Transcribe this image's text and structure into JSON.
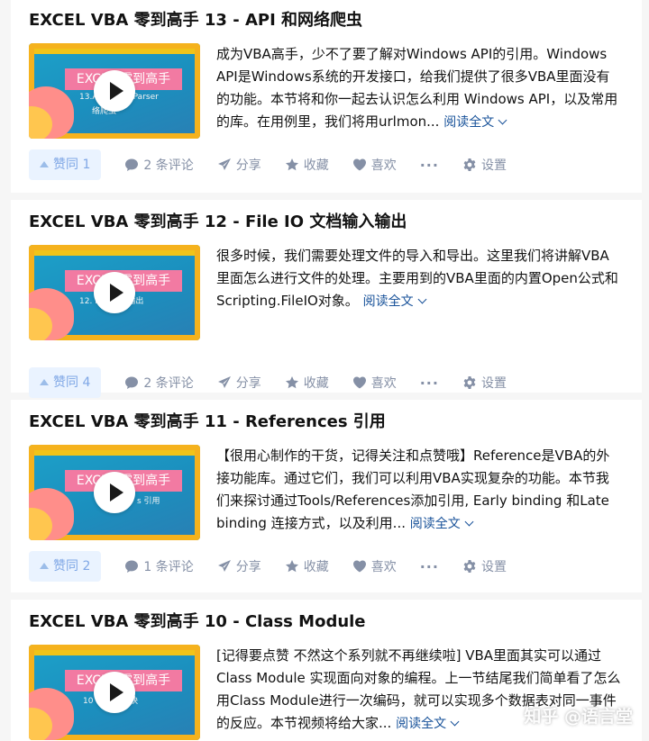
{
  "articles": [
    {
      "title": "EXCEL VBA 零到高手 13 - API 和网络爬虫",
      "excerpt_lines": [
        "成为VBA高手，少不了要了解对Windows API的引用。Windows",
        "API是Windows系统的开发接口，给我们提供了很多VBA里面没有",
        "的功能。本节将和你一起去认识怎么利用 Windows API，以及常用"
      ],
      "excerpt_last": "的库。在用例里，我们将用urlmon...",
      "thumb_title": "EXCEL 零到高手",
      "thumb_sub": "13.A... HTML Parser",
      "thumb_sub2": "络爬虫",
      "vote": "赞同 1",
      "comments": "2 条评论"
    },
    {
      "title": "EXCEL VBA 零到高手 12 - File IO 文档输入输出",
      "excerpt_lines": [
        "很多时候，我们需要处理文件的导入和导出。这里我们将讲解VBA",
        "里面怎么进行文件的处理。主要用到的VBA里面的内置Open公式和"
      ],
      "excerpt_last": "Scripting.FileIO对象。",
      "thumb_title": "EXCEL 零到高手",
      "thumb_sub": "12. F... 输入/输出",
      "thumb_sub2": "",
      "vote": "赞同 4",
      "comments": "2 条评论"
    },
    {
      "title": "EXCEL VBA 零到高手 11 - References 引用",
      "excerpt_lines": [
        "【很用心制作的干货，记得关注和点赞哦】Reference是VBA的外",
        "接功能库。通过它们，我们可以利用VBA实现复杂的功能。本节我",
        "们来探讨通过Tools/References添加引用, Early binding 和Late"
      ],
      "excerpt_last": "binding 连接方式，以及利用...",
      "thumb_title": "EXCEL 零到高手",
      "thumb_sub": "s 引用",
      "thumb_sub2": "",
      "vote": "赞同 2",
      "comments": "1 条评论"
    },
    {
      "title": "EXCEL VBA 零到高手 10 - Class Module",
      "excerpt_lines": [
        "[记得要点赞 不然这个系列就不再继续啦] VBA里面其实可以通过",
        "Class Module 实现面向对象的编程。上一节结尾我们简单看了怎么",
        "用Class Module进行一次编码，就可以实现多个数据表对同一事件"
      ],
      "excerpt_last": "的反应。本节视频将给大家...",
      "thumb_title": "EXCEL 零到高手",
      "thumb_sub": "10 ... e 类模块",
      "thumb_sub2": "",
      "vote": "",
      "comments": ""
    }
  ],
  "labels": {
    "read_more": "阅读全文",
    "share": "分享",
    "favorite": "收藏",
    "like": "喜欢",
    "more": "···",
    "settings": "设置"
  },
  "icons": [
    "play-icon",
    "comment-icon",
    "share-icon",
    "star-icon",
    "heart-icon",
    "more-icon",
    "gear-icon",
    "chevron-down-icon",
    "upvote-icon"
  ],
  "watermark": "知乎 @语言堂"
}
